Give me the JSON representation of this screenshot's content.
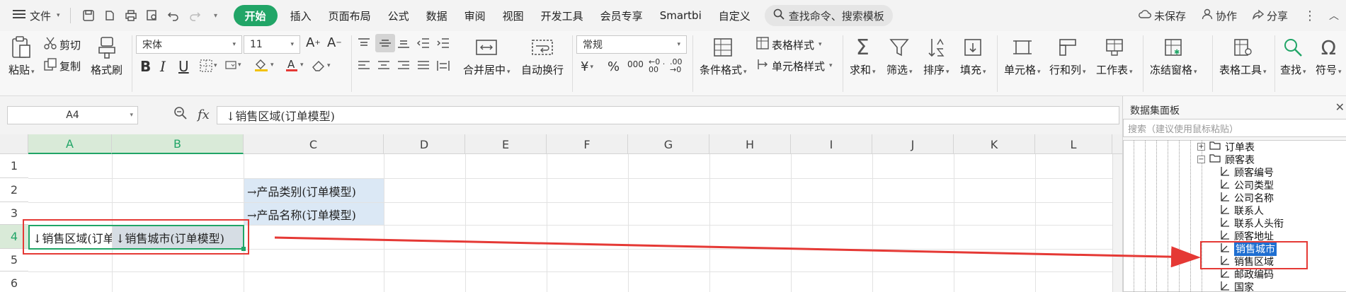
{
  "menubar": {
    "file_label": "文件",
    "tabs": [
      "开始",
      "插入",
      "页面布局",
      "公式",
      "数据",
      "审阅",
      "视图",
      "开发工具",
      "会员专享",
      "Smartbi",
      "自定义"
    ],
    "search_placeholder": "查找命令、搜索模板",
    "unsaved": "未保存",
    "collab": "协作",
    "share": "分享"
  },
  "ribbon": {
    "paste": "粘贴",
    "cut": "剪切",
    "copy": "复制",
    "format_painter": "格式刷",
    "font_name": "宋体",
    "font_size": "11",
    "merge_center": "合并居中",
    "wrap_text": "自动换行",
    "number_format": "常规",
    "conditional_format": "条件格式",
    "table_style": "表格样式",
    "cell_style": "单元格样式",
    "sum": "求和",
    "filter": "筛选",
    "sort": "排序",
    "fill": "填充",
    "cells": "单元格",
    "rows_cols": "行和列",
    "worksheet": "工作表",
    "freeze": "冻结窗格",
    "table_tools": "表格工具",
    "find": "查找",
    "symbol": "符号",
    "bold": "B",
    "italic": "I",
    "underline": "U",
    "pct": "%",
    "thousands": "000",
    "dec_inc": "←0 .00",
    "dec_dec": ".00 →0"
  },
  "formula_bar": {
    "name_box": "A4",
    "fx": "fx",
    "content": "↓销售区域(订单模型)"
  },
  "sheet": {
    "columns": [
      "A",
      "B",
      "C",
      "D",
      "E",
      "F",
      "G",
      "H",
      "I",
      "J",
      "K",
      "L"
    ],
    "rows": [
      "1",
      "2",
      "3",
      "4",
      "5",
      "6"
    ],
    "c2": "→产品类别(订单模型)",
    "c3": "→产品名称(订单模型)",
    "a4": "↓销售区域(订单模型)",
    "b4": "↓销售城市(订单模型)"
  },
  "panel": {
    "title": "数据集面板",
    "search_placeholder": "搜索（建议使用鼠标粘贴）",
    "tree": {
      "order_table": "订单表",
      "customer_table": "顾客表",
      "fields": [
        "顾客编号",
        "公司类型",
        "公司名称",
        "联系人",
        "联系人头衔",
        "顾客地址",
        "销售城市",
        "销售区域",
        "邮政编码",
        "国家"
      ]
    }
  }
}
